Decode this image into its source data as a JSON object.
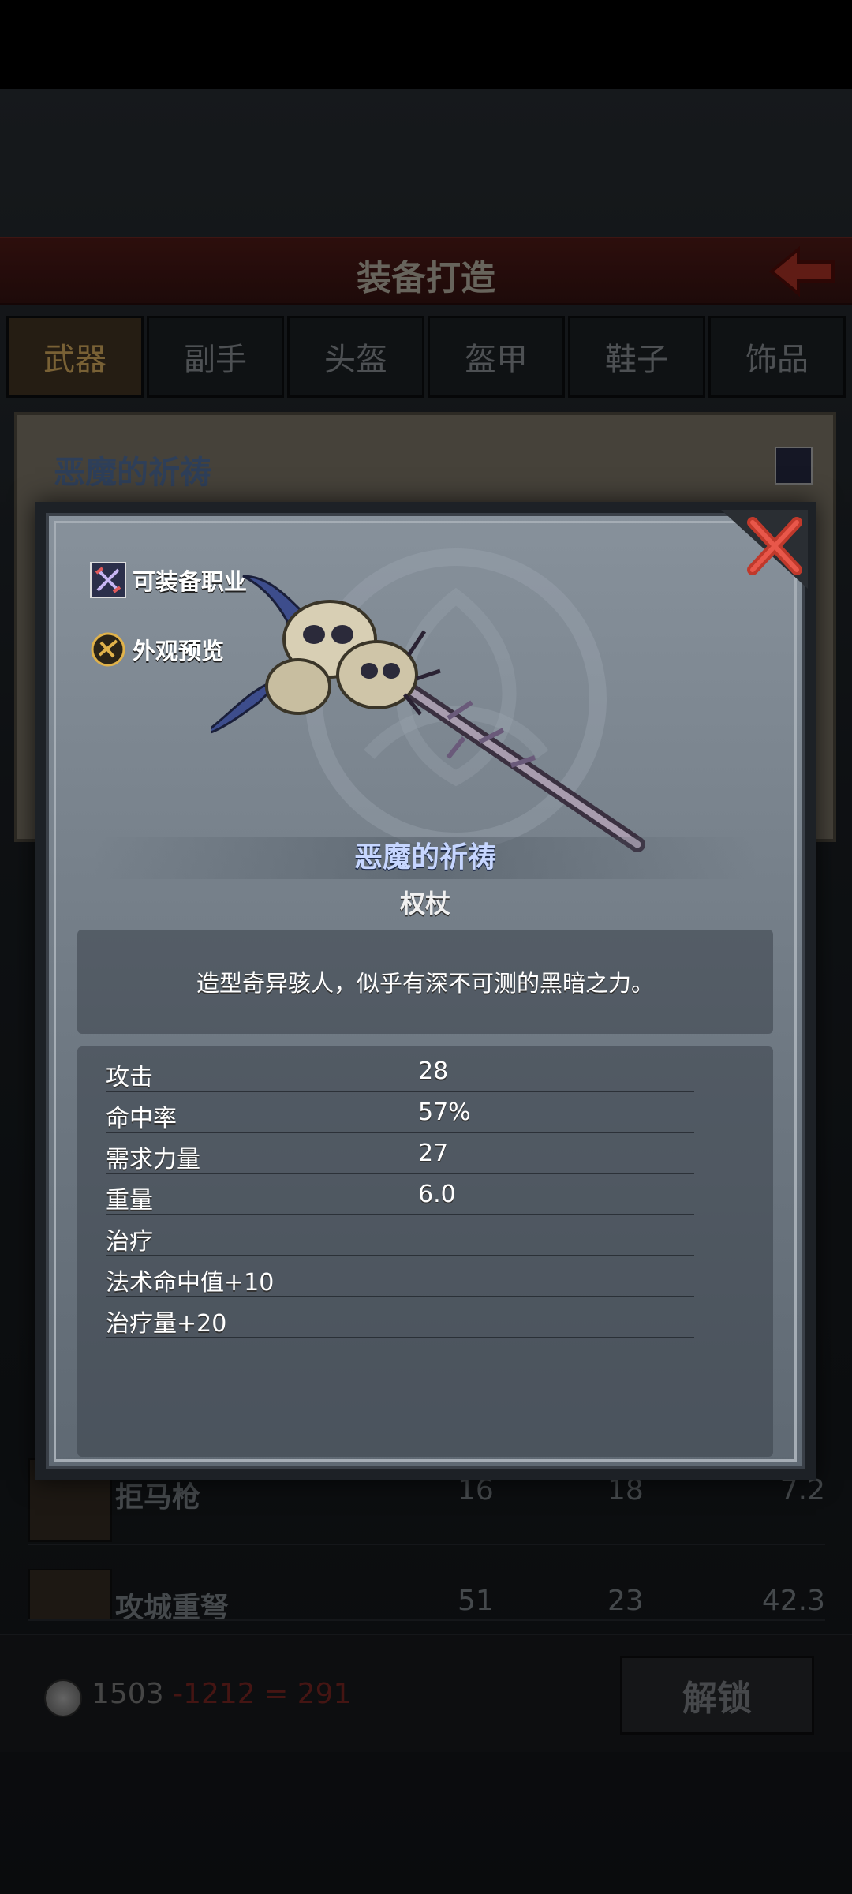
{
  "header": {
    "title": "装备打造"
  },
  "tabs": [
    {
      "label": "武器"
    },
    {
      "label": "副手"
    },
    {
      "label": "头盔"
    },
    {
      "label": "盔甲"
    },
    {
      "label": "鞋子"
    },
    {
      "label": "饰品"
    }
  ],
  "card": {
    "title": "恶魔的祈祷"
  },
  "list_rows": [
    {
      "name": "拒马枪",
      "v1": "16",
      "v2": "18",
      "v3": "7.2"
    },
    {
      "name": "攻城重弩",
      "v1": "51",
      "v2": "23",
      "v3": "42.3"
    }
  ],
  "footer": {
    "balance": "1503",
    "cost_expr": "-1212 = 291",
    "unlock_label": "解锁"
  },
  "modal": {
    "equip_class_label": "可装备职业",
    "preview_label": "外观预览",
    "item_name": "恶魔的祈祷",
    "item_type": "权杖",
    "description": "造型奇异骇人，似乎有深不可测的黑暗之力。",
    "stats": [
      {
        "key": "攻击",
        "value": "28"
      },
      {
        "key": "命中率",
        "value": "57%"
      },
      {
        "key": "需求力量",
        "value": "27"
      },
      {
        "key": "重量",
        "value": "6.0"
      },
      {
        "key": "治疗",
        "value": ""
      },
      {
        "key": "法术命中值+10",
        "value": ""
      },
      {
        "key": "治疗量+20",
        "value": ""
      }
    ]
  },
  "colors": {
    "header_red": "#5a1d1a",
    "active_tab_text": "#f2c26a",
    "item_name": "#c6d6ff",
    "cost_red": "#8a2b26"
  }
}
